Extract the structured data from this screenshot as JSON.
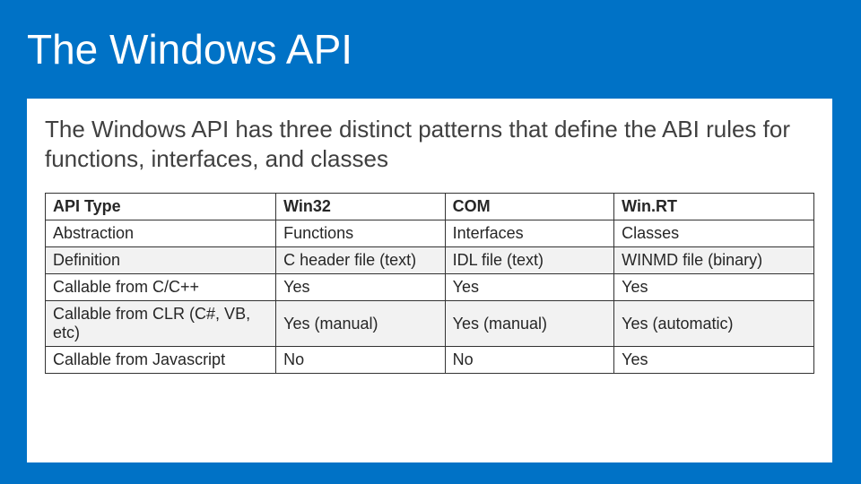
{
  "title": "The Windows API",
  "subtitle": "The Windows API has three distinct patterns that define the ABI rules for functions, interfaces, and classes",
  "chart_data": {
    "type": "table",
    "headers": [
      "API Type",
      "Win32",
      "COM",
      "Win.RT"
    ],
    "rows": [
      [
        "Abstraction",
        "Functions",
        "Interfaces",
        "Classes"
      ],
      [
        "Definition",
        "C header file (text)",
        "IDL file (text)",
        "WINMD file (binary)"
      ],
      [
        "Callable from C/C++",
        "Yes",
        "Yes",
        "Yes"
      ],
      [
        "Callable from CLR (C#, VB, etc)",
        "Yes (manual)",
        "Yes (manual)",
        "Yes (automatic)"
      ],
      [
        "Callable from Javascript",
        "No",
        "No",
        "Yes"
      ]
    ]
  }
}
